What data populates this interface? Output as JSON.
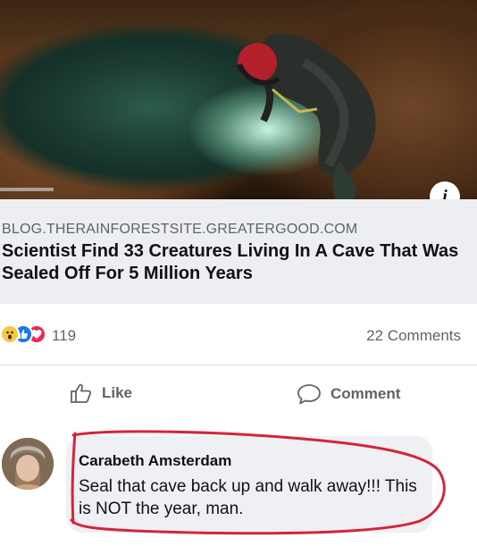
{
  "post": {
    "link": {
      "domain": "BLOG.THERAINFORESTSITE.GREATERGOOD.COM",
      "title": "Scientist Find 33 Creatures Living In A Cave That Was Sealed Off For 5 Million Years",
      "info_glyph": "i"
    },
    "reactions": {
      "types": [
        "wow",
        "like",
        "love"
      ],
      "count": "119",
      "comments_label": "22 Comments"
    },
    "actions": {
      "like_label": "Like",
      "comment_label": "Comment"
    },
    "comment": {
      "author": "Carabeth Amsterdam",
      "text": "Seal that cave back up and walk away!!! This is NOT the year, man.",
      "annotation_color": "#d3253a"
    }
  }
}
